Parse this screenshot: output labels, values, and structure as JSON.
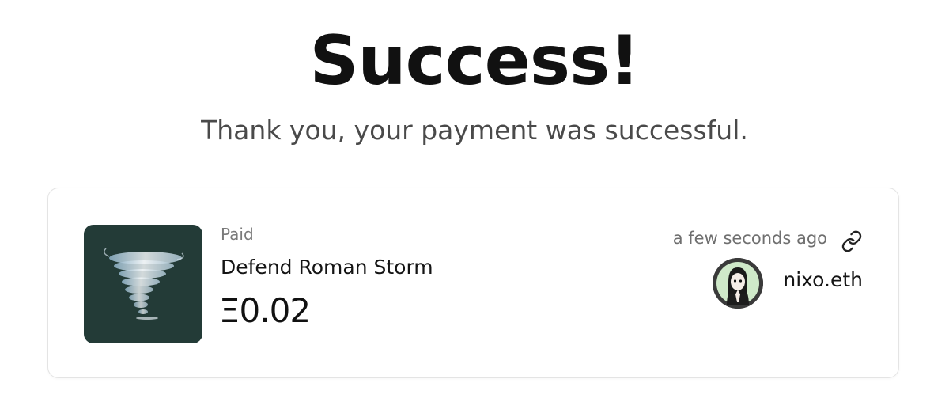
{
  "header": {
    "title": "Success!",
    "subtitle": "Thank you, your payment was successful."
  },
  "payment": {
    "status": "Paid",
    "campaign": "Defend Roman Storm",
    "amount": "Ξ0.02",
    "time": "a few seconds ago",
    "username": "nixo.eth",
    "thumbnail_icon": "tornado-image",
    "link_icon": "link-icon",
    "thumbnail_bg": "#233b37"
  }
}
